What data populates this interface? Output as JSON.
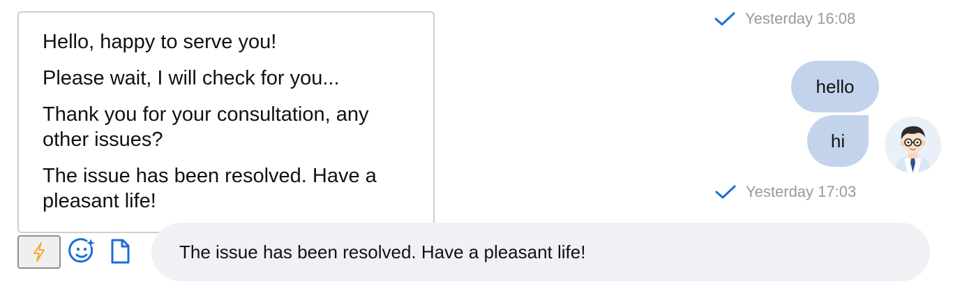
{
  "colors": {
    "accent": "#1a6fd8",
    "bubble": "#c3d3ec",
    "quick_icon": "#f5a623",
    "timestamp": "#999999",
    "input_bg": "#f0f1f5"
  },
  "timestamps": [
    {
      "text": "Yesterday 16:08",
      "icon": "check-icon"
    },
    {
      "text": "Yesterday 17:03",
      "icon": "check-icon"
    }
  ],
  "messages": [
    {
      "text": "hello",
      "from": "me"
    },
    {
      "text": "hi",
      "from": "me"
    }
  ],
  "quick_replies": [
    "Hello, happy to serve you!",
    "Please wait, I will check for you...",
    "Thank you for your consultation, any other issues?",
    "The issue has been resolved. Have a pleasant life!"
  ],
  "toolbar": {
    "quick_reply_icon": "lightning-icon",
    "emoji_icon": "smiley-icon",
    "file_icon": "file-icon"
  },
  "input": {
    "value": "The issue has been resolved. Have a pleasant life!"
  }
}
